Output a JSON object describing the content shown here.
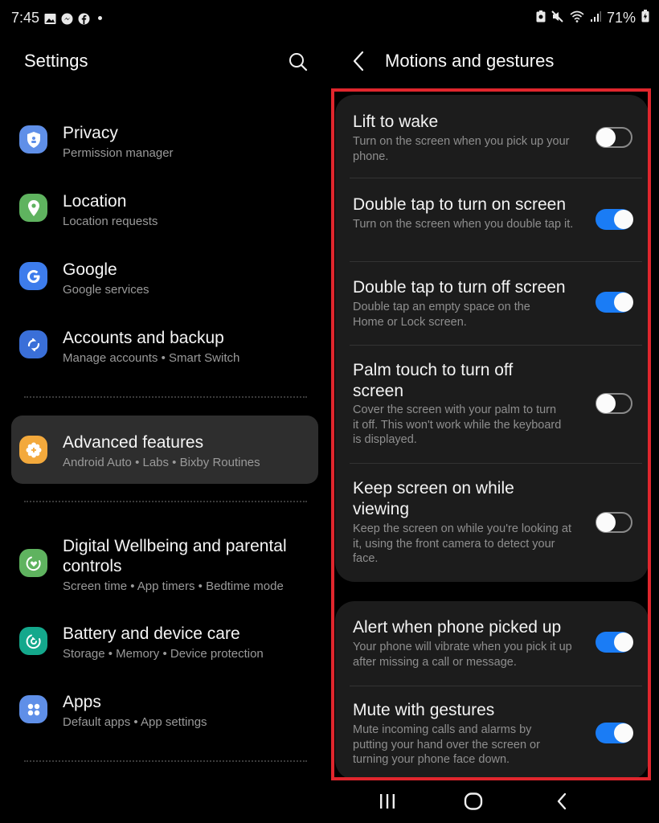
{
  "status_bar": {
    "time": "7:45",
    "left_icons": [
      "gallery-icon",
      "messenger-icon",
      "facebook-icon",
      "notification-dot"
    ],
    "right_icons": [
      "battery-saver-icon",
      "mute-icon",
      "wifi-icon",
      "signal-icon"
    ],
    "battery_percent": "71%"
  },
  "left_pane": {
    "title": "Settings",
    "search_icon": "search-icon",
    "items": [
      {
        "title": "Privacy",
        "subtitle": "Permission manager",
        "icon": "shield-icon",
        "color": "#5f8fe8"
      },
      {
        "title": "Location",
        "subtitle": "Location requests",
        "icon": "location-pin-icon",
        "color": "#5fb35f"
      },
      {
        "title": "Google",
        "subtitle": "Google services",
        "icon": "google-icon",
        "color": "#3d7cec"
      },
      {
        "title": "Accounts and backup",
        "subtitle": "Manage accounts  •  Smart Switch",
        "icon": "sync-icon",
        "color": "#3a6fd8"
      },
      {
        "title": "Advanced features",
        "subtitle": "Android Auto  •  Labs  •  Bixby Routines",
        "icon": "gear-plus-icon",
        "color": "#f3a93c",
        "selected": true
      },
      {
        "title": "Digital Wellbeing and parental",
        "title2": "controls",
        "subtitle": "Screen time  •  App timers  •  Bedtime mode",
        "icon": "wellbeing-icon",
        "color": "#5fb35f"
      },
      {
        "title": "Battery and device care",
        "subtitle": "Storage  •  Memory  •  Device protection",
        "icon": "device-care-icon",
        "color": "#14a88c"
      },
      {
        "title": "Apps",
        "subtitle": "Default apps  •  App settings",
        "icon": "apps-icon",
        "color": "#5f8fe8"
      }
    ]
  },
  "right_pane": {
    "title": "Motions and gestures",
    "back_icon": "back-chevron-icon",
    "highlight_color": "#e0262d",
    "toggle_on_color": "#1a7cf5",
    "cards": [
      {
        "rows": [
          {
            "title": "Lift to wake",
            "subtitle": "Turn on the screen when you pick up your phone.",
            "enabled": false
          },
          {
            "title": "Double tap to turn on screen",
            "subtitle": "Turn on the screen when you double tap it.",
            "enabled": true
          },
          {
            "title": "Double tap to turn off screen",
            "subtitle": "Double tap an empty space on the Home or Lock screen.",
            "enabled": true
          },
          {
            "title": "Palm touch to turn off screen",
            "subtitle": "Cover the screen with your palm to turn it off. This won't work while the keyboard is displayed.",
            "enabled": false
          },
          {
            "title": "Keep screen on while viewing",
            "subtitle": "Keep the screen on while you're looking at it, using the front camera to detect your face.",
            "enabled": false
          }
        ]
      },
      {
        "rows": [
          {
            "title": "Alert when phone picked up",
            "subtitle": "Your phone will vibrate when you pick it up after missing a call or message.",
            "enabled": true
          },
          {
            "title": "Mute with gestures",
            "subtitle": "Mute incoming calls and alarms by putting your hand over the screen or turning your phone face down.",
            "enabled": true
          }
        ]
      }
    ]
  },
  "nav_bar": {
    "buttons": [
      "recents-icon",
      "home-icon",
      "back-icon"
    ]
  }
}
